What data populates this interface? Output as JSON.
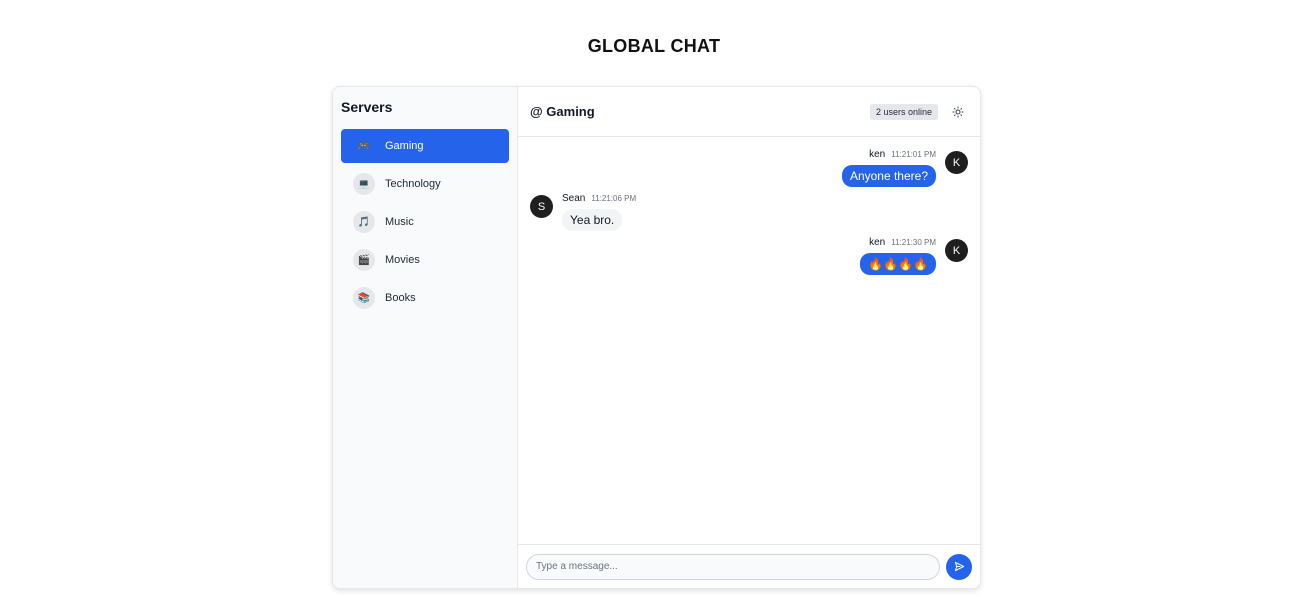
{
  "page": {
    "title": "GLOBAL CHAT"
  },
  "sidebar": {
    "title": "Servers",
    "items": [
      {
        "label": "Gaming",
        "icon": "🎮",
        "icon_name": "gamepad-icon",
        "active": true
      },
      {
        "label": "Technology",
        "icon": "💻",
        "icon_name": "laptop-icon",
        "active": false
      },
      {
        "label": "Music",
        "icon": "🎵",
        "icon_name": "music-note-icon",
        "active": false
      },
      {
        "label": "Movies",
        "icon": "🎬",
        "icon_name": "clapperboard-icon",
        "active": false
      },
      {
        "label": "Books",
        "icon": "📚",
        "icon_name": "books-icon",
        "active": false
      }
    ]
  },
  "header": {
    "channel": "@ Gaming",
    "online": "2 users online",
    "theme_icon": "sun-icon"
  },
  "messages": [
    {
      "side": "right",
      "initial": "K",
      "user": "ken",
      "time": "11:21:01 PM",
      "text": "Anyone there?"
    },
    {
      "side": "left",
      "initial": "S",
      "user": "Sean",
      "time": "11:21:06 PM",
      "text": "Yea bro."
    },
    {
      "side": "right",
      "initial": "K",
      "user": "ken",
      "time": "11:21:30 PM",
      "text": "🔥🔥🔥🔥"
    }
  ],
  "composer": {
    "placeholder": "Type a message...",
    "value": "",
    "send_icon": "send-icon"
  },
  "colors": {
    "accent": "#2563eb",
    "avatar": "#1f1f1f"
  }
}
